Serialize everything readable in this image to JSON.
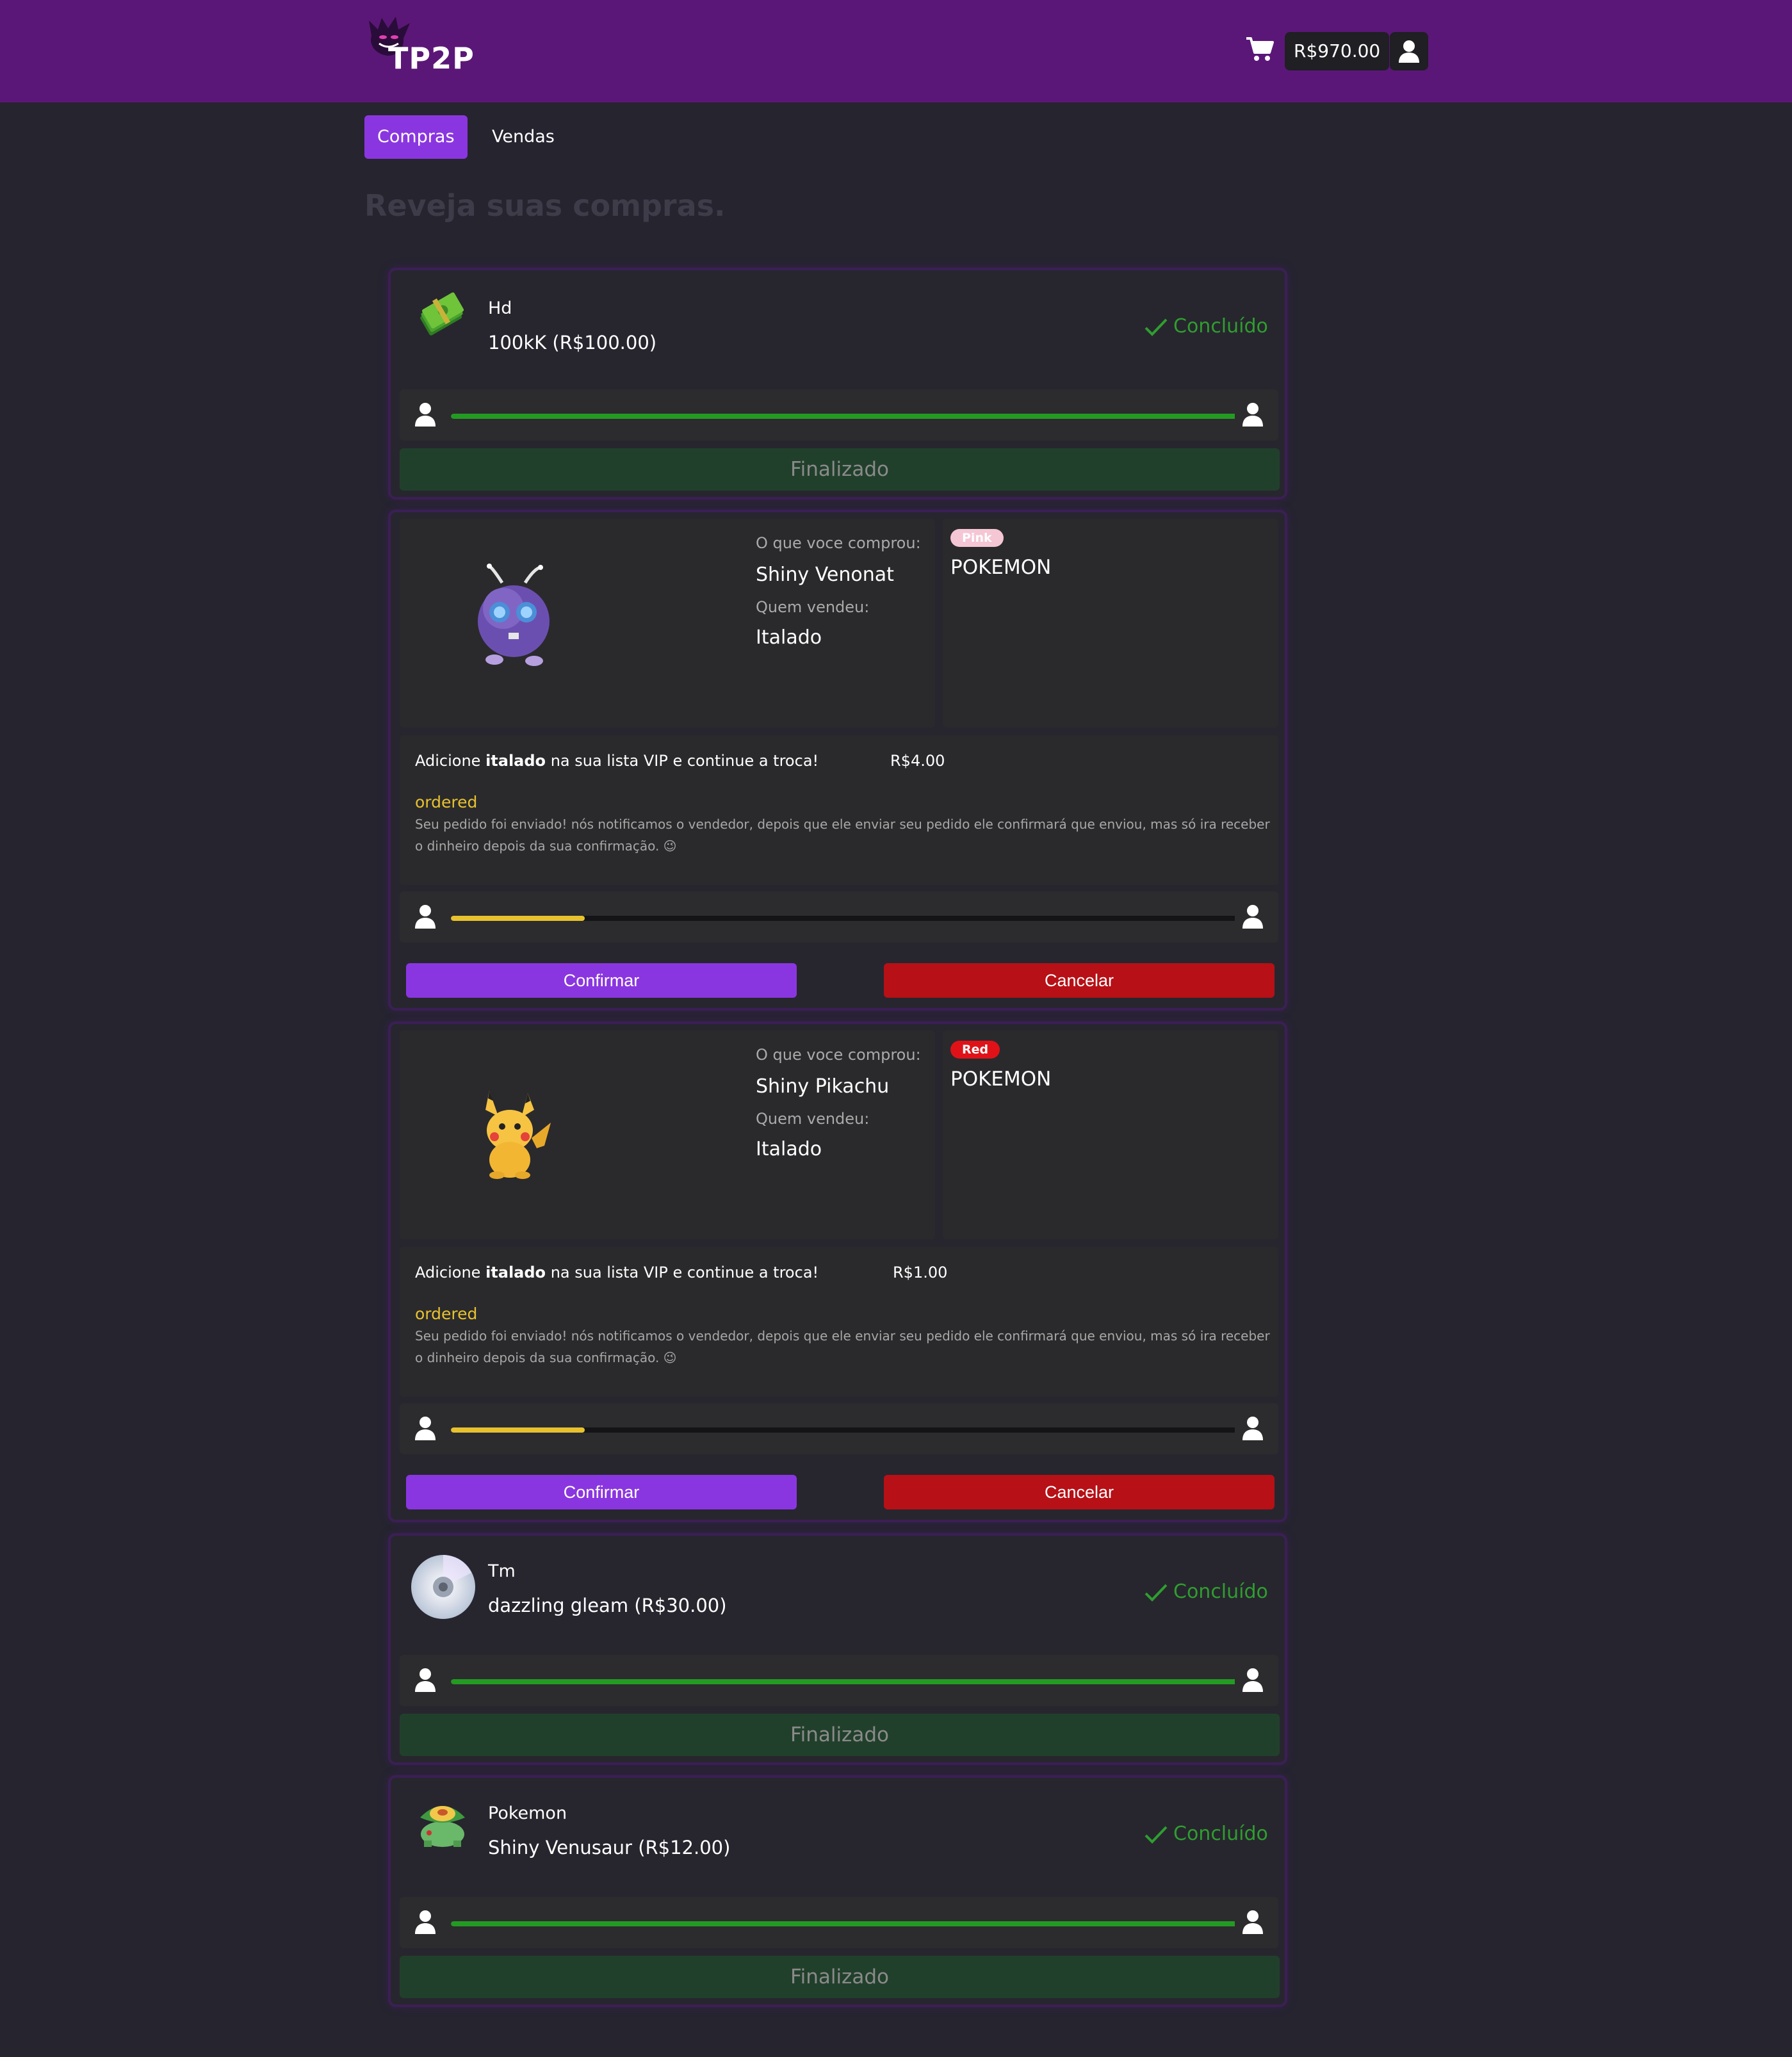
{
  "header": {
    "logo_text": "TP2P",
    "balance": "R$970.00"
  },
  "tabs": [
    {
      "label": "Compras",
      "active": true
    },
    {
      "label": "Vendas",
      "active": false
    }
  ],
  "page_heading": "Reveja suas compras.",
  "colors": {
    "accent": "#8a36e0",
    "header": "#5b1777",
    "done": "#2f9e2f",
    "pending": "#e8c22e",
    "cancel": "#b71016"
  },
  "orders": [
    {
      "type": "summary",
      "icon": "money-stack-icon",
      "category": "Hd",
      "item": "100kK (R$100.00)",
      "status": "Concluído",
      "progress": 1.0,
      "footer": "Finalizado"
    },
    {
      "type": "detailed",
      "icon": "venonat-sprite",
      "bought_label": "O que voce comprou:",
      "item_name": "Shiny Venonat",
      "seller_label": "Quem vendeu:",
      "seller": "Italado",
      "tag": "Pink",
      "category": "POKEMON",
      "vip_prefix": "Adicione",
      "vip_name": "italado",
      "vip_suffix": "na sua lista VIP e continue a troca!",
      "price": "R$4.00",
      "state": "ordered",
      "notice": "Seu pedido foi enviado! nós notificamos o vendedor, depois que ele enviar seu pedido ele confirmará que enviou, mas só ira receber o dinheiro depois da sua confirmação. 😉",
      "progress": 0.17,
      "confirm": "Confirmar",
      "cancel": "Cancelar"
    },
    {
      "type": "detailed",
      "icon": "pikachu-sprite",
      "bought_label": "O que voce comprou:",
      "item_name": "Shiny Pikachu",
      "seller_label": "Quem vendeu:",
      "seller": "Italado",
      "tag": "Red",
      "category": "POKEMON",
      "vip_prefix": "Adicione",
      "vip_name": "italado",
      "vip_suffix": "na sua lista VIP e continue a troca!",
      "price": "R$1.00",
      "state": "ordered",
      "notice": "Seu pedido foi enviado! nós notificamos o vendedor, depois que ele enviar seu pedido ele confirmará que enviou, mas só ira receber o dinheiro depois da sua confirmação. 😉",
      "progress": 0.17,
      "confirm": "Confirmar",
      "cancel": "Cancelar"
    },
    {
      "type": "summary",
      "icon": "cd-disc-icon",
      "category": "Tm",
      "item": "dazzling gleam (R$30.00)",
      "status": "Concluído",
      "progress": 1.0,
      "footer": "Finalizado"
    },
    {
      "type": "summary",
      "icon": "venusaur-sprite",
      "category": "Pokemon",
      "item": "Shiny Venusaur (R$12.00)",
      "status": "Concluído",
      "progress": 1.0,
      "footer": "Finalizado"
    }
  ]
}
